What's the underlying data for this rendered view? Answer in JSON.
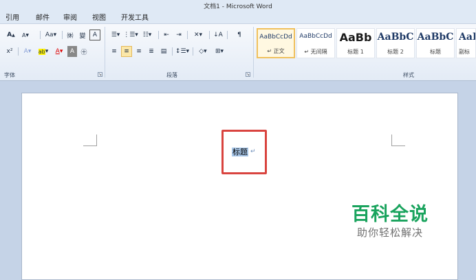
{
  "window": {
    "title": "文档1 - Microsoft Word"
  },
  "menu_tabs": [
    "引用",
    "邮件",
    "审阅",
    "视图",
    "开发工具"
  ],
  "ribbon": {
    "font_group": {
      "label": "字体",
      "row1": [
        "A",
        "A",
        "Aa",
        "變",
        "A"
      ],
      "row2": [
        "x²",
        "A",
        "ab",
        "A",
        "A",
        "⊕"
      ]
    },
    "paragraph_group": {
      "label": "段落"
    },
    "styles_group": {
      "label": "样式",
      "tiles": [
        {
          "sample": "AaBbCcDd",
          "name": "↵ 正文"
        },
        {
          "sample": "AaBbCcDd",
          "name": "↵ 无间隔"
        },
        {
          "sample": "AaBb",
          "name": "标题 1"
        },
        {
          "sample": "AaBbC",
          "name": "标题 2"
        },
        {
          "sample": "AaBbC",
          "name": "标题"
        },
        {
          "sample": "AaB",
          "name": "副标"
        }
      ]
    }
  },
  "document": {
    "selected_text": "标题",
    "paragraph_mark": "↵"
  },
  "watermark": {
    "title": "百科全说",
    "subtitle": "助你轻松解决"
  },
  "colors": {
    "watermark_green": "#19a35d",
    "highlight_box": "#d9443f",
    "selection": "#a9c8ea"
  }
}
